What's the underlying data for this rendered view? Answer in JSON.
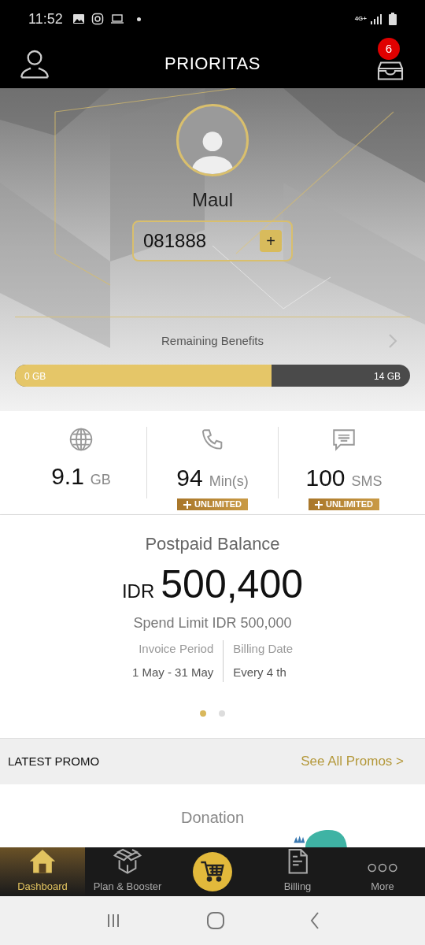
{
  "status_bar": {
    "time": "11:52",
    "network": "4G+"
  },
  "header": {
    "title": "PRIORITAS",
    "notification_count": "6"
  },
  "profile": {
    "name": "Maul",
    "phone": "081888",
    "add_label": "+"
  },
  "benefits": {
    "label": "Remaining Benefits",
    "min_label": "0 GB",
    "max_label": "14 GB",
    "level": 0.65
  },
  "quotas": [
    {
      "kind": "data",
      "value": "9.1",
      "unit": "GB",
      "unlimited": false
    },
    {
      "kind": "voice",
      "value": "94",
      "unit": "Min(s)",
      "unlimited": true,
      "badge": "UNLIMITED"
    },
    {
      "kind": "sms",
      "value": "100",
      "unit": "SMS",
      "unlimited": true,
      "badge": "UNLIMITED"
    }
  ],
  "balance": {
    "title": "Postpaid Balance",
    "currency": "IDR",
    "amount": "500,400",
    "spend_limit": "Spend Limit IDR 500,000",
    "invoice_label": "Invoice Period",
    "invoice_value": "1 May - 31 May",
    "billing_label": "Billing Date",
    "billing_value": "Every 4 th"
  },
  "pager": [
    {
      "selected": true
    },
    {
      "selected": false
    }
  ],
  "promo": {
    "title": "LATEST PROMO",
    "link": "See All Promos >",
    "card_title": "Donation"
  },
  "nav": [
    {
      "kind": "home",
      "label": "Dashboard",
      "selected": true
    },
    {
      "kind": "box",
      "label": "Plan & Booster",
      "selected": false
    },
    {
      "kind": "cart",
      "selected": false
    },
    {
      "kind": "doc",
      "label": "Billing",
      "selected": false
    },
    {
      "kind": "more",
      "label": "More",
      "selected": false
    }
  ]
}
